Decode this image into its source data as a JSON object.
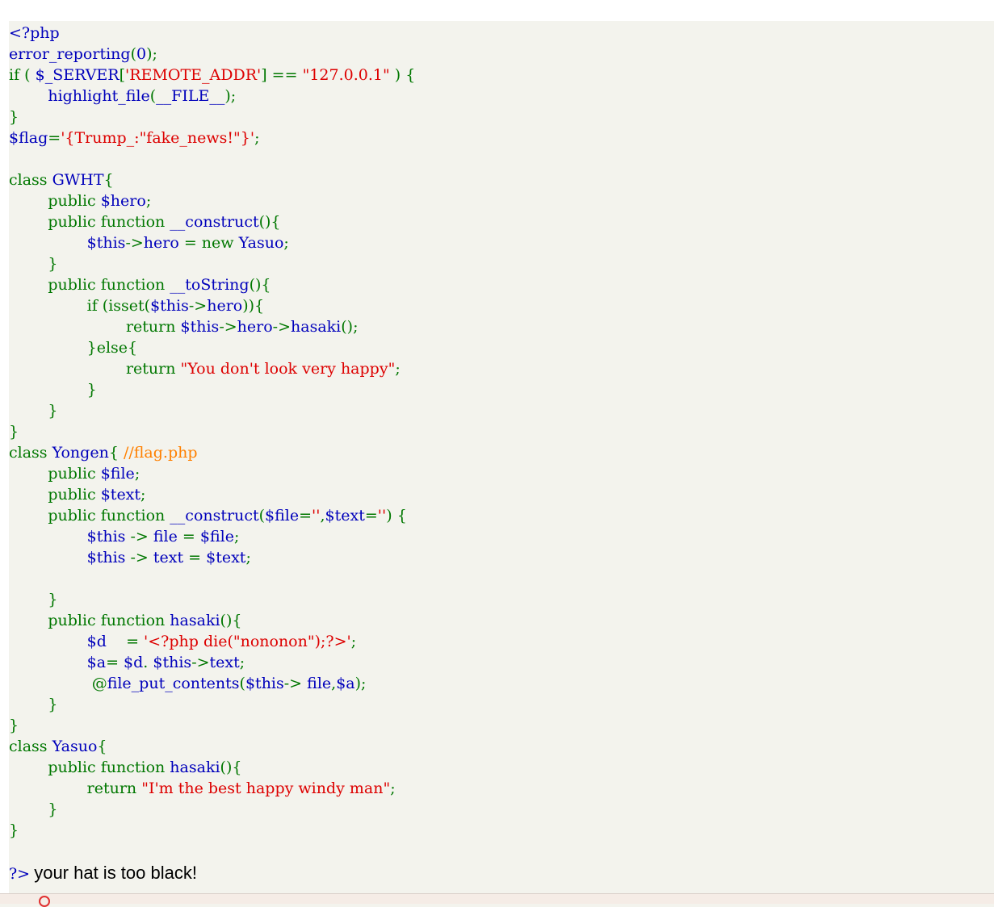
{
  "source_lines": [
    [
      {
        "t": "<?php",
        "c": "default"
      }
    ],
    [
      {
        "t": "error_reporting",
        "c": "default"
      },
      {
        "t": "(",
        "c": "keyword"
      },
      {
        "t": "0",
        "c": "default"
      },
      {
        "t": ");",
        "c": "keyword"
      }
    ],
    [
      {
        "t": "if ( ",
        "c": "keyword"
      },
      {
        "t": "$_SERVER",
        "c": "default"
      },
      {
        "t": "[",
        "c": "keyword"
      },
      {
        "t": "'REMOTE_ADDR'",
        "c": "string"
      },
      {
        "t": "] == ",
        "c": "keyword"
      },
      {
        "t": "\"127.0.0.1\"",
        "c": "string"
      },
      {
        "t": " ) {",
        "c": "keyword"
      }
    ],
    [
      {
        "t": "        ",
        "c": "keyword"
      },
      {
        "t": "highlight_file",
        "c": "default"
      },
      {
        "t": "(",
        "c": "keyword"
      },
      {
        "t": "__FILE__",
        "c": "default"
      },
      {
        "t": ");",
        "c": "keyword"
      }
    ],
    [
      {
        "t": "}",
        "c": "keyword"
      }
    ],
    [
      {
        "t": "$flag",
        "c": "default"
      },
      {
        "t": "=",
        "c": "keyword"
      },
      {
        "t": "'{Trump_:\"fake_news!\"}'",
        "c": "string"
      },
      {
        "t": ";",
        "c": "keyword"
      }
    ],
    [],
    [
      {
        "t": "class ",
        "c": "keyword"
      },
      {
        "t": "GWHT",
        "c": "default"
      },
      {
        "t": "{",
        "c": "keyword"
      }
    ],
    [
      {
        "t": "        public ",
        "c": "keyword"
      },
      {
        "t": "$hero",
        "c": "default"
      },
      {
        "t": ";",
        "c": "keyword"
      }
    ],
    [
      {
        "t": "        public function ",
        "c": "keyword"
      },
      {
        "t": "__construct",
        "c": "default"
      },
      {
        "t": "(){",
        "c": "keyword"
      }
    ],
    [
      {
        "t": "                ",
        "c": "keyword"
      },
      {
        "t": "$this",
        "c": "default"
      },
      {
        "t": "->",
        "c": "keyword"
      },
      {
        "t": "hero ",
        "c": "default"
      },
      {
        "t": "= new ",
        "c": "keyword"
      },
      {
        "t": "Yasuo",
        "c": "default"
      },
      {
        "t": ";",
        "c": "keyword"
      }
    ],
    [
      {
        "t": "        }",
        "c": "keyword"
      }
    ],
    [
      {
        "t": "        public function ",
        "c": "keyword"
      },
      {
        "t": "__toString",
        "c": "default"
      },
      {
        "t": "(){",
        "c": "keyword"
      }
    ],
    [
      {
        "t": "                if (isset(",
        "c": "keyword"
      },
      {
        "t": "$this",
        "c": "default"
      },
      {
        "t": "->",
        "c": "keyword"
      },
      {
        "t": "hero",
        "c": "default"
      },
      {
        "t": ")){",
        "c": "keyword"
      }
    ],
    [
      {
        "t": "                        return ",
        "c": "keyword"
      },
      {
        "t": "$this",
        "c": "default"
      },
      {
        "t": "->",
        "c": "keyword"
      },
      {
        "t": "hero",
        "c": "default"
      },
      {
        "t": "->",
        "c": "keyword"
      },
      {
        "t": "hasaki",
        "c": "default"
      },
      {
        "t": "();",
        "c": "keyword"
      }
    ],
    [
      {
        "t": "                }else{",
        "c": "keyword"
      }
    ],
    [
      {
        "t": "                        return ",
        "c": "keyword"
      },
      {
        "t": "\"You don't look very happy\"",
        "c": "string"
      },
      {
        "t": ";",
        "c": "keyword"
      }
    ],
    [
      {
        "t": "                }",
        "c": "keyword"
      }
    ],
    [
      {
        "t": "        }",
        "c": "keyword"
      }
    ],
    [
      {
        "t": "}",
        "c": "keyword"
      }
    ],
    [
      {
        "t": "class ",
        "c": "keyword"
      },
      {
        "t": "Yongen",
        "c": "default"
      },
      {
        "t": "{ ",
        "c": "keyword"
      },
      {
        "t": "//flag.php",
        "c": "comment"
      }
    ],
    [
      {
        "t": "        public ",
        "c": "keyword"
      },
      {
        "t": "$file",
        "c": "default"
      },
      {
        "t": ";",
        "c": "keyword"
      }
    ],
    [
      {
        "t": "        public ",
        "c": "keyword"
      },
      {
        "t": "$text",
        "c": "default"
      },
      {
        "t": ";",
        "c": "keyword"
      }
    ],
    [
      {
        "t": "        public function ",
        "c": "keyword"
      },
      {
        "t": "__construct",
        "c": "default"
      },
      {
        "t": "(",
        "c": "keyword"
      },
      {
        "t": "$file",
        "c": "default"
      },
      {
        "t": "=",
        "c": "keyword"
      },
      {
        "t": "''",
        "c": "string"
      },
      {
        "t": ",",
        "c": "keyword"
      },
      {
        "t": "$text",
        "c": "default"
      },
      {
        "t": "=",
        "c": "keyword"
      },
      {
        "t": "''",
        "c": "string"
      },
      {
        "t": ") {",
        "c": "keyword"
      }
    ],
    [
      {
        "t": "                ",
        "c": "keyword"
      },
      {
        "t": "$this ",
        "c": "default"
      },
      {
        "t": "-> ",
        "c": "keyword"
      },
      {
        "t": "file ",
        "c": "default"
      },
      {
        "t": "= ",
        "c": "keyword"
      },
      {
        "t": "$file",
        "c": "default"
      },
      {
        "t": ";",
        "c": "keyword"
      }
    ],
    [
      {
        "t": "                ",
        "c": "keyword"
      },
      {
        "t": "$this ",
        "c": "default"
      },
      {
        "t": "-> ",
        "c": "keyword"
      },
      {
        "t": "text ",
        "c": "default"
      },
      {
        "t": "= ",
        "c": "keyword"
      },
      {
        "t": "$text",
        "c": "default"
      },
      {
        "t": ";",
        "c": "keyword"
      }
    ],
    [],
    [
      {
        "t": "        }",
        "c": "keyword"
      }
    ],
    [
      {
        "t": "        public function ",
        "c": "keyword"
      },
      {
        "t": "hasaki",
        "c": "default"
      },
      {
        "t": "(){",
        "c": "keyword"
      }
    ],
    [
      {
        "t": "                ",
        "c": "keyword"
      },
      {
        "t": "$d    ",
        "c": "default"
      },
      {
        "t": "= ",
        "c": "keyword"
      },
      {
        "t": "'<?php die(\"nononon\");?>'",
        "c": "string"
      },
      {
        "t": ";",
        "c": "keyword"
      }
    ],
    [
      {
        "t": "                ",
        "c": "keyword"
      },
      {
        "t": "$a",
        "c": "default"
      },
      {
        "t": "= ",
        "c": "keyword"
      },
      {
        "t": "$d",
        "c": "default"
      },
      {
        "t": ". ",
        "c": "keyword"
      },
      {
        "t": "$this",
        "c": "default"
      },
      {
        "t": "->",
        "c": "keyword"
      },
      {
        "t": "text",
        "c": "default"
      },
      {
        "t": ";",
        "c": "keyword"
      }
    ],
    [
      {
        "t": "                 ",
        "c": "keyword"
      },
      {
        "t": "@",
        "c": "keyword"
      },
      {
        "t": "file_put_contents",
        "c": "default"
      },
      {
        "t": "(",
        "c": "keyword"
      },
      {
        "t": "$this",
        "c": "default"
      },
      {
        "t": "-> ",
        "c": "keyword"
      },
      {
        "t": "file",
        "c": "default"
      },
      {
        "t": ",",
        "c": "keyword"
      },
      {
        "t": "$a",
        "c": "default"
      },
      {
        "t": ");",
        "c": "keyword"
      }
    ],
    [
      {
        "t": "        }",
        "c": "keyword"
      }
    ],
    [
      {
        "t": "}",
        "c": "keyword"
      }
    ],
    [
      {
        "t": "class ",
        "c": "keyword"
      },
      {
        "t": "Yasuo",
        "c": "default"
      },
      {
        "t": "{",
        "c": "keyword"
      }
    ],
    [
      {
        "t": "        public function ",
        "c": "keyword"
      },
      {
        "t": "hasaki",
        "c": "default"
      },
      {
        "t": "(){",
        "c": "keyword"
      }
    ],
    [
      {
        "t": "                return ",
        "c": "keyword"
      },
      {
        "t": "\"I'm the best happy windy man\"",
        "c": "string"
      },
      {
        "t": ";",
        "c": "keyword"
      }
    ],
    [
      {
        "t": "        }",
        "c": "keyword"
      }
    ],
    [
      {
        "t": "}",
        "c": "keyword"
      }
    ],
    []
  ],
  "trailer": {
    "close_tag": "?>",
    "message": "your hat is too black!"
  },
  "colors": {
    "default": "#0000bb",
    "keyword": "#007700",
    "string": "#dd0000",
    "comment": "#ff8000",
    "background": "#f3f3ed"
  }
}
